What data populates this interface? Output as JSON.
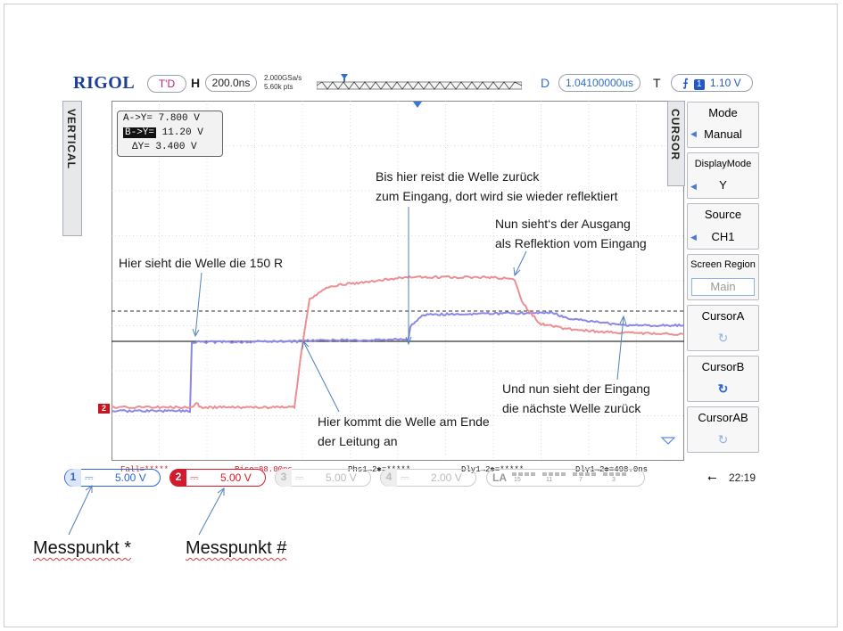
{
  "header": {
    "brand": "RIGOL",
    "trigger_status": "T'D",
    "timebase_label": "H",
    "timebase_value": "200.0ns",
    "sample_rate": "2.000GSa/s",
    "memory_depth": "5.60k pts",
    "delay_label": "D",
    "delay_value": "1.04100000us",
    "trigger_label": "T",
    "trigger_channel": "1",
    "trigger_level": "1.10 V"
  },
  "left_tab": {
    "label": "VERTICAL"
  },
  "cursor_readout": {
    "a_label": "A->Y=",
    "a_value": "7.800 V",
    "b_label": "B->Y=",
    "b_value": "11.20 V",
    "d_label": "ΔY=",
    "d_value": "3.400 V"
  },
  "menu": {
    "tab_label": "CURSOR",
    "items": [
      {
        "title": "Mode",
        "value": "Manual"
      },
      {
        "title": "DisplayMode",
        "value": "Y"
      },
      {
        "title": "Source",
        "value": "CH1"
      },
      {
        "title": "Screen Region",
        "value": "Main"
      },
      {
        "title": "CursorA",
        "value": "↻"
      },
      {
        "title": "CursorB",
        "value": "↻"
      },
      {
        "title": "CursorAB",
        "value": "↻"
      }
    ]
  },
  "measurements": {
    "fall": "Fall=*****",
    "rise": "Rise=88.00ns",
    "phase": "Phs1→2✱=*****",
    "delay_rr": "Dly1→2✱=*****",
    "delay_ff": "Dly1→2✱=498.0ns"
  },
  "channels": [
    {
      "num": "1",
      "coupling": "⎓",
      "scale": "5.00 V",
      "color": "#2c64d6"
    },
    {
      "num": "2",
      "coupling": "⎓",
      "scale": "5.00 V",
      "color": "#d21c2e"
    },
    {
      "num": "3",
      "coupling": "⎓",
      "scale": "5.00 V",
      "color": "#bbbbbb"
    },
    {
      "num": "4",
      "coupling": "⎓",
      "scale": "2.00 V",
      "color": "#bbbbbb"
    }
  ],
  "la": {
    "label": "LA",
    "groups": [
      "15",
      "11",
      "7",
      "3"
    ]
  },
  "status": {
    "time": "22:19"
  },
  "annotations": {
    "a1": "Hier sieht die Welle die 150 R",
    "a2_line1": "Bis hier reist die Welle zurück",
    "a2_line2": "zum Eingang, dort wird sie wieder reflektiert",
    "a3_line1": "Nun sieht‘s der Ausgang",
    "a3_line2": "als Reflektion vom Eingang",
    "a4_line1": "Hier kommt die Welle am Ende",
    "a4_line2": "der Leitung an",
    "a5_line1": "Und nun sieht der Eingang",
    "a5_line2": "die nächste Welle zurück"
  },
  "callouts": {
    "mp1": "Messpunkt *",
    "mp2": "Messpunkt #"
  },
  "colors": {
    "ch1_trace": "#8c86e6",
    "ch2_trace": "#ec8f93",
    "cursor_line": "#333333",
    "grid": "#c8c8c8"
  },
  "waveforms": {
    "ch1": [
      [
        0,
        0
      ],
      [
        88,
        0
      ],
      [
        90,
        -77
      ],
      [
        208,
        -78
      ],
      [
        212,
        -79
      ],
      [
        330,
        -80
      ],
      [
        333,
        -82
      ],
      [
        335,
        -95
      ],
      [
        350,
        -108
      ],
      [
        480,
        -110
      ],
      [
        495,
        -110
      ],
      [
        510,
        -104
      ],
      [
        540,
        -100
      ],
      [
        575,
        -96
      ],
      [
        642,
        -96
      ]
    ],
    "ch2": [
      [
        0,
        -4
      ],
      [
        90,
        -4
      ],
      [
        95,
        -9
      ],
      [
        100,
        -4
      ],
      [
        205,
        -4
      ],
      [
        212,
        -60
      ],
      [
        222,
        -125
      ],
      [
        245,
        -140
      ],
      [
        330,
        -150
      ],
      [
        420,
        -150
      ],
      [
        450,
        -148
      ],
      [
        452,
        -146
      ],
      [
        460,
        -122
      ],
      [
        480,
        -98
      ],
      [
        510,
        -92
      ],
      [
        560,
        -88
      ],
      [
        642,
        -86
      ]
    ]
  }
}
